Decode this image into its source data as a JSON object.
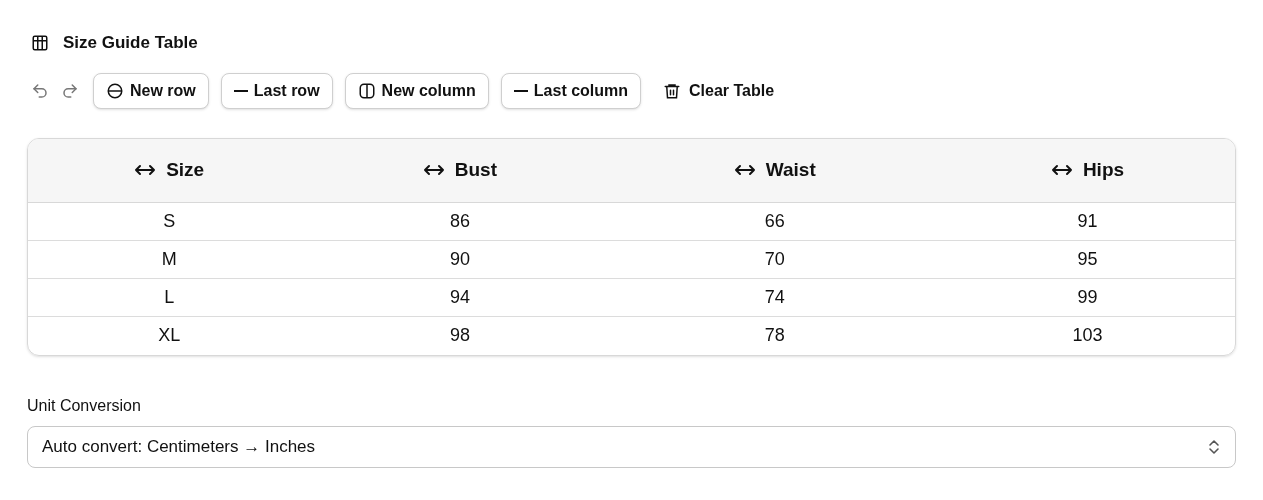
{
  "title": "Size Guide Table",
  "toolbar": [
    {
      "kind": "new-row",
      "label": "New row"
    },
    {
      "kind": "last-row",
      "label": "Last row"
    },
    {
      "kind": "new-column",
      "label": "New column"
    },
    {
      "kind": "last-column",
      "label": "Last column"
    },
    {
      "kind": "clear",
      "label": "Clear Table"
    }
  ],
  "table": {
    "columns": [
      "Size",
      "Bust",
      "Waist",
      "Hips"
    ],
    "rows": [
      [
        "S",
        "86",
        "66",
        "91"
      ],
      [
        "M",
        "90",
        "70",
        "95"
      ],
      [
        "L",
        "94",
        "74",
        "99"
      ],
      [
        "XL",
        "98",
        "78",
        "103"
      ]
    ]
  },
  "unit_conversion": {
    "label": "Unit Conversion",
    "value": "Auto convert: Centimeters → Inches"
  }
}
